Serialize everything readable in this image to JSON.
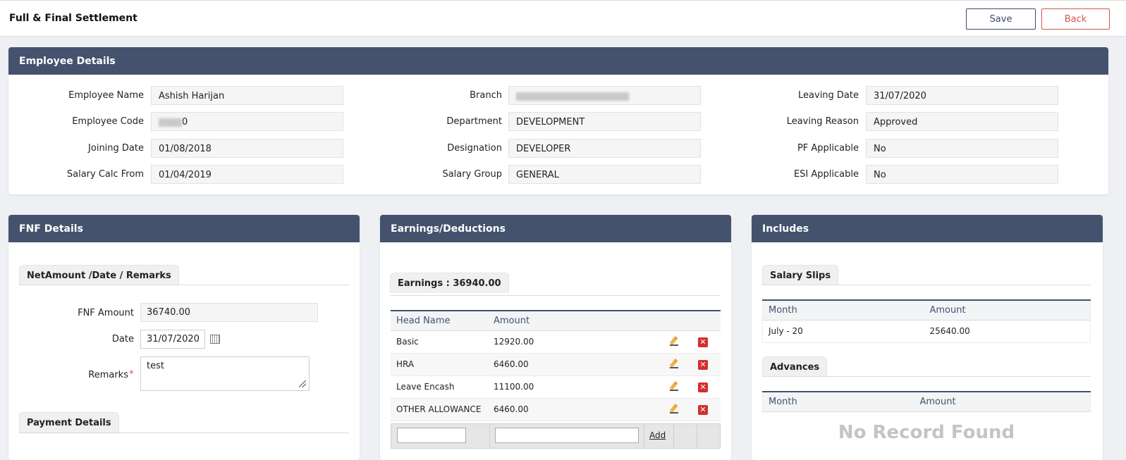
{
  "header": {
    "title": "Full & Final Settlement",
    "save_label": "Save",
    "back_label": "Back"
  },
  "employee": {
    "title": "Employee Details",
    "fields": {
      "name_label": "Employee Name",
      "name_value": "Ashish Harijan",
      "code_label": "Employee Code",
      "code_value": "0",
      "joining_label": "Joining Date",
      "joining_value": "01/08/2018",
      "salcalc_label": "Salary Calc From",
      "salcalc_value": "01/04/2019",
      "branch_label": "Branch",
      "branch_value": "",
      "dept_label": "Department",
      "dept_value": "DEVELOPMENT",
      "desig_label": "Designation",
      "desig_value": "DEVELOPER",
      "salgroup_label": "Salary Group",
      "salgroup_value": "GENERAL",
      "leaving_label": "Leaving Date",
      "leaving_value": "31/07/2020",
      "reason_label": "Leaving Reason",
      "reason_value": "Approved",
      "pf_label": "PF Applicable",
      "pf_value": "No",
      "esi_label": "ESI Applicable",
      "esi_value": "No"
    }
  },
  "fnf": {
    "title": "FNF Details",
    "tab1": "NetAmount /Date / Remarks",
    "amount_label": "FNF Amount",
    "amount_value": "36740.00",
    "date_label": "Date",
    "date_value": "31/07/2020",
    "remarks_label": "Remarks",
    "remarks_required": "*",
    "remarks_value": "test",
    "tab2": "Payment Details"
  },
  "earnings": {
    "title": "Earnings/Deductions",
    "tab": "Earnings : 36940.00",
    "col_head": "Head Name",
    "col_amount": "Amount",
    "rows": [
      {
        "head": "Basic",
        "amount": "12920.00"
      },
      {
        "head": "HRA",
        "amount": "6460.00"
      },
      {
        "head": "Leave Encash",
        "amount": "11100.00"
      },
      {
        "head": "OTHER ALLOWANCE",
        "amount": "6460.00"
      }
    ],
    "add_label": "Add",
    "delete_glyph": "✕"
  },
  "includes": {
    "title": "Includes",
    "slips_tab": "Salary Slips",
    "col_month": "Month",
    "col_amount": "Amount",
    "slips": [
      {
        "month": "July - 20",
        "amount": "25640.00"
      }
    ],
    "advances_tab": "Advances",
    "no_record": "No Record Found"
  }
}
